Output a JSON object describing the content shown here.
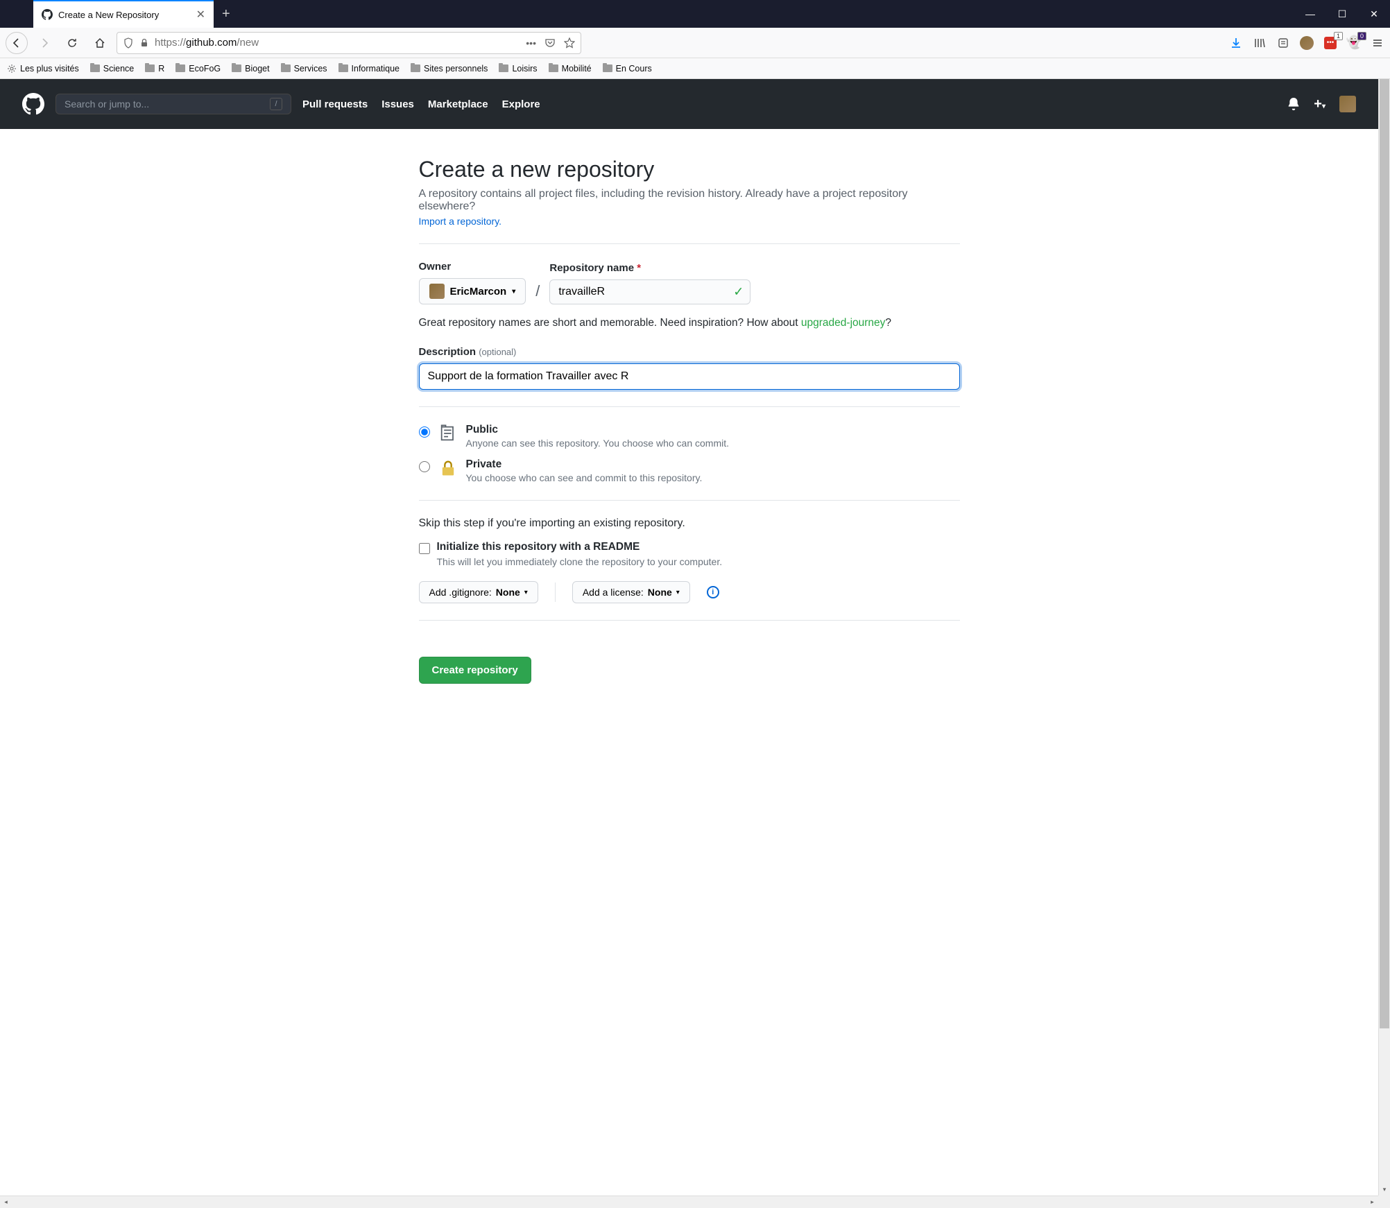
{
  "browser": {
    "tab_title": "Create a New Repository",
    "url_scheme": "https://",
    "url_domain": "github.com",
    "url_path": "/new",
    "bookmarks": {
      "most_visited": "Les plus visités",
      "folders": [
        "Science",
        "R",
        "EcoFoG",
        "Bioget",
        "Services",
        "Informatique",
        "Sites personnels",
        "Loisirs",
        "Mobilité",
        "En Cours"
      ]
    },
    "ext_badges": {
      "red": "1",
      "ghost": "0"
    }
  },
  "github": {
    "search_placeholder": "Search or jump to...",
    "nav": {
      "pull_requests": "Pull requests",
      "issues": "Issues",
      "marketplace": "Marketplace",
      "explore": "Explore"
    }
  },
  "page": {
    "title": "Create a new repository",
    "subtitle": "A repository contains all project files, including the revision history. Already have a project repository elsewhere?",
    "import_link": "Import a repository.",
    "owner_label": "Owner",
    "owner_name": "EricMarcon",
    "repo_label": "Repository name",
    "repo_value": "travailleR",
    "hint_pre": "Great repository names are short and memorable. Need inspiration? How about ",
    "hint_suggest": "upgraded-journey",
    "hint_post": "?",
    "desc_label": "Description",
    "desc_optional": "(optional)",
    "desc_value": "Support de la formation Travailler avec R",
    "visibility": {
      "public_title": "Public",
      "public_desc": "Anyone can see this repository. You choose who can commit.",
      "private_title": "Private",
      "private_desc": "You choose who can see and commit to this repository."
    },
    "skip_text": "Skip this step if you're importing an existing repository.",
    "readme_title": "Initialize this repository with a README",
    "readme_desc": "This will let you immediately clone the repository to your computer.",
    "gitignore_pre": "Add .gitignore: ",
    "gitignore_val": "None",
    "license_pre": "Add a license: ",
    "license_val": "None",
    "create_label": "Create repository"
  }
}
